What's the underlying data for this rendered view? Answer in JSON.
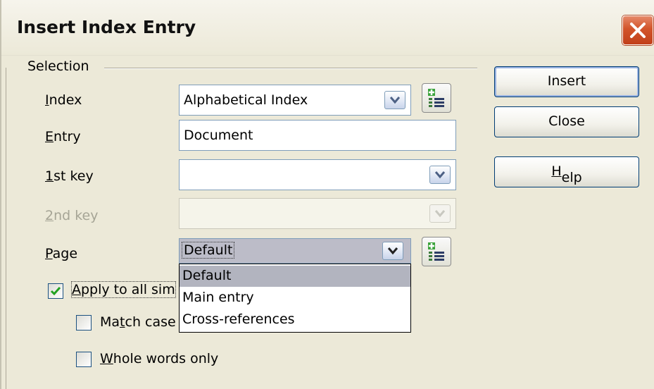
{
  "window": {
    "title": "Insert Index Entry",
    "close_icon": "close-icon"
  },
  "selection": {
    "group_label": "Selection",
    "index": {
      "label_mnemonic": "I",
      "label_rest": "ndex",
      "value": "Alphabetical Index"
    },
    "entry": {
      "label_mnemonic": "E",
      "label_rest": "ntry",
      "value": "Document"
    },
    "key1": {
      "label_mnemonic": "1",
      "label_rest": "st key",
      "value": ""
    },
    "key2": {
      "label_mnemonic": "2",
      "label_rest": "nd key",
      "value": "",
      "enabled": false
    },
    "page": {
      "label_mnemonic": "P",
      "label_rest": "age",
      "value": "Default",
      "options": [
        "Default",
        "Main entry",
        "Cross-references"
      ],
      "selected_index": 0
    },
    "apply_all": {
      "label_mnemonic": "A",
      "label_rest": "pply to all sim",
      "checked": true
    },
    "match_case": {
      "label_pre": "Ma",
      "label_mnemonic": "t",
      "label_rest": "ch case",
      "checked": false
    },
    "whole_words": {
      "label_mnemonic": "W",
      "label_rest": "hole words only",
      "checked": false
    }
  },
  "buttons": {
    "insert": "Insert",
    "close": "Close",
    "help_mnemonic": "H",
    "help_rest": "elp"
  }
}
